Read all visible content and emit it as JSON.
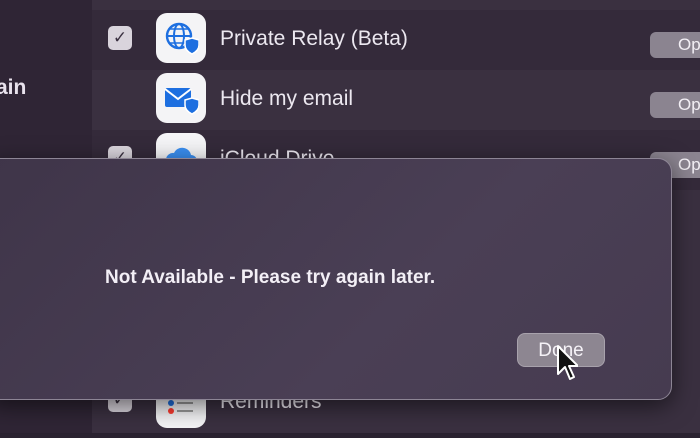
{
  "sidebar": {
    "fragment_text": "ain"
  },
  "services": [
    {
      "label": "Private Relay (Beta)",
      "checked": true,
      "icon": "globe-shield-icon",
      "button": "Op"
    },
    {
      "label": "Hide my email",
      "checked": false,
      "icon": "mail-shield-icon",
      "button": "Op"
    },
    {
      "label": "iCloud Drive",
      "checked": true,
      "icon": "cloud-icon",
      "button": "Op"
    },
    {
      "label": "Reminders",
      "checked": true,
      "icon": "list-icon",
      "button": ""
    }
  ],
  "dialog": {
    "message": "Not Available - Please try again later.",
    "done_label": "Done"
  },
  "colors": {
    "background": "#2a2230",
    "dialog": "#463b50",
    "accent_icon": "#1d6fe0"
  }
}
